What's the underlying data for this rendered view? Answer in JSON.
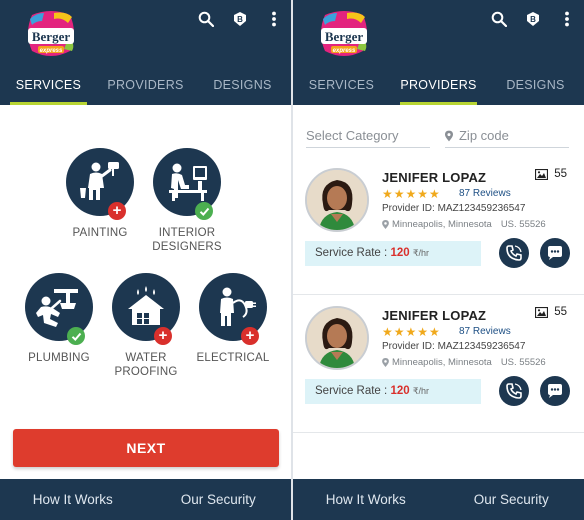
{
  "brand": {
    "logo_text": "Berger",
    "logo_subtext": "express"
  },
  "colors": {
    "primary": "#1d3750",
    "accent_tab": "#b8d533",
    "next_button": "#de3c2d",
    "add_badge": "#d9302c",
    "check_badge": "#4caf50",
    "star": "#f0a91c",
    "rate_bg": "#ddf3f8"
  },
  "header_icons": [
    "search-icon",
    "badge-b-icon",
    "more-vert-icon"
  ],
  "tabs": [
    {
      "label": "SERVICES"
    },
    {
      "label": "PROVIDERS"
    },
    {
      "label": "DESIGNS"
    }
  ],
  "left_screen": {
    "active_tab": "SERVICES",
    "services": [
      {
        "label": "PAINTING",
        "icon": "painter-icon",
        "badge": "add"
      },
      {
        "label": "INTERIOR\nDESIGNERS",
        "icon": "interior-designer-icon",
        "badge": "check"
      },
      {
        "label": "PLUMBING",
        "icon": "plumber-icon",
        "badge": "check"
      },
      {
        "label": "WATER\nPROOFING",
        "icon": "water-proofing-icon",
        "badge": "add"
      },
      {
        "label": "ELECTRICAL",
        "icon": "electrician-icon",
        "badge": "add"
      }
    ],
    "next_label": "NEXT"
  },
  "right_screen": {
    "active_tab": "PROVIDERS",
    "category_placeholder": "Select Category",
    "zip_placeholder": "Zip code",
    "providers": [
      {
        "name": "JENIFER LOPAZ",
        "rating": 5,
        "reviews": "87 Reviews",
        "provider_id": "Provider ID: MAZ123459236547",
        "location": "Minneapolis, Minnesota",
        "country_zip": "US. 55526",
        "photos": "55",
        "rate_label": "Service Rate :",
        "rate_value": "120",
        "rate_unit": "₹/hr"
      },
      {
        "name": "JENIFER LOPAZ",
        "rating": 5,
        "reviews": "87 Reviews",
        "provider_id": "Provider ID: MAZ123459236547",
        "location": "Minneapolis, Minnesota",
        "country_zip": "US. 55526",
        "photos": "55",
        "rate_label": "Service Rate :",
        "rate_value": "120",
        "rate_unit": "₹/hr"
      }
    ]
  },
  "footer": {
    "how_it_works": "How It Works",
    "our_security": "Our Security"
  }
}
